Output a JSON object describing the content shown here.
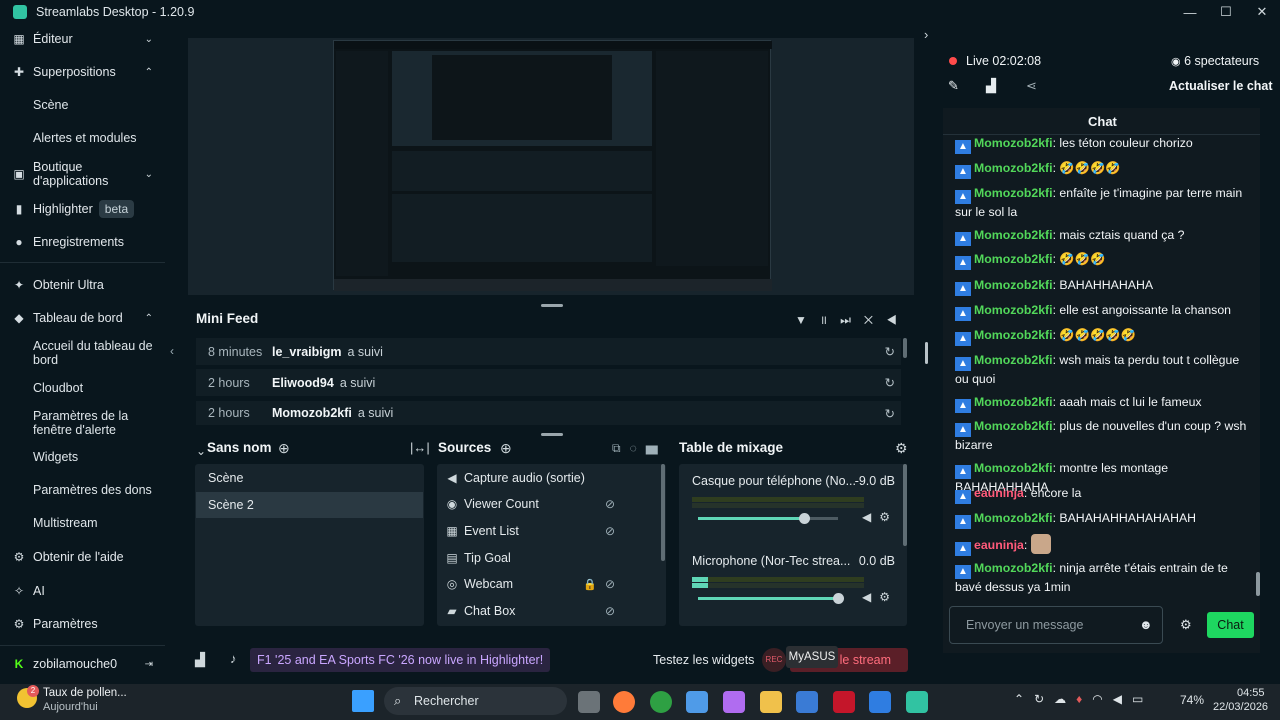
{
  "app": {
    "title": "Streamlabs Desktop - 1.20.9"
  },
  "window_controls": {
    "minimize": "—",
    "maximize": "☐",
    "close": "✕"
  },
  "sidebar": {
    "editor": "Éditeur",
    "overlays": "Superpositions",
    "scene": "Scène",
    "alerts": "Alertes et modules",
    "app_store": "Boutique d'applications",
    "highlighter": "Highlighter",
    "highlighter_badge": "beta",
    "recordings": "Enregistrements",
    "ultra": "Obtenir Ultra",
    "dashboard": "Tableau de bord",
    "dash_home": "Accueil du tableau de bord",
    "cloudbot": "Cloudbot",
    "alertbox_settings": "Paramètres de la fenêtre d'alerte",
    "widgets": "Widgets",
    "donation_settings": "Paramètres des dons",
    "multistream": "Multistream",
    "help": "Obtenir de l'aide",
    "ai": "AI",
    "settings": "Paramètres",
    "user": "zobilamouche0"
  },
  "minifeed": {
    "title": "Mini Feed",
    "rows": [
      {
        "time": "8 minutes",
        "user": "le_vraibigm",
        "action": "a suivi"
      },
      {
        "time": "2 hours",
        "user": "Eliwood94",
        "action": "a suivi"
      },
      {
        "time": "2 hours",
        "user": "Momozob2kfi",
        "action": "a suivi"
      }
    ]
  },
  "scenes": {
    "title": "Sans nom",
    "items": [
      "Scène",
      "Scène 2"
    ]
  },
  "sources": {
    "title": "Sources",
    "items": [
      "Capture audio (sortie)",
      "Viewer Count",
      "Event List",
      "Tip Goal",
      "Webcam",
      "Chat Box"
    ]
  },
  "mixer": {
    "title": "Table de mixage",
    "channels": [
      {
        "name": "Casque pour téléphone (No...",
        "db": "-9.0 dB",
        "level": 0.76
      },
      {
        "name": "Microphone (Nor-Tec strea...",
        "db": "0.0 dB",
        "level": 1.0
      }
    ]
  },
  "bottom": {
    "banner": "F1 '25 and EA Sports FC '26 now live in Highlighter!",
    "test_widgets": "Testez les widgets",
    "rec": "REC",
    "go_live": "r le stream",
    "tooltip": "MyASUS"
  },
  "live": {
    "status": "Live",
    "time": "02:02:08",
    "viewers": "6 spectateurs",
    "refresh": "Actualiser le chat"
  },
  "chat": {
    "title": "Chat",
    "messages": [
      {
        "user": "Momozob2kfi",
        "text": "les téton couleur chorizo"
      },
      {
        "user": "Momozob2kfi",
        "text": "🤣🤣🤣🤣"
      },
      {
        "user": "Momozob2kfi",
        "text": "enfaîte je t'imagine par terre main sur le sol la"
      },
      {
        "user": "Momozob2kfi",
        "text": "mais cztais quand ça ?"
      },
      {
        "user": "Momozob2kfi",
        "text": "🤣🤣🤣"
      },
      {
        "user": "Momozob2kfi",
        "text": "BAHAHHAHAHA"
      },
      {
        "user": "Momozob2kfi",
        "text": "elle est angoissante la chanson"
      },
      {
        "user": "Momozob2kfi",
        "text": "🤣🤣🤣🤣🤣"
      },
      {
        "user": "Momozob2kfi",
        "text": "wsh mais ta perdu tout t collègue ou quoi"
      },
      {
        "user": "Momozob2kfi",
        "text": "aaah mais ct lui le fameux"
      },
      {
        "user": "Momozob2kfi",
        "text": "plus de nouvelles d'un coup ? wsh bizarre"
      },
      {
        "user": "Momozob2kfi",
        "text": "montre les montage BAHAHAHHAHA"
      },
      {
        "user": "eauninja",
        "text": "encore la"
      },
      {
        "user": "Momozob2kfi",
        "text": "BAHAHAHHAHAHAHAH"
      },
      {
        "user": "eauninja",
        "text": ""
      },
      {
        "user": "Momozob2kfi",
        "text": "ninja arrête t'étais entrain de te bavé dessus ya 1min"
      }
    ],
    "input_placeholder": "Envoyer un message",
    "send": "Chat"
  },
  "taskbar": {
    "weather_title": "Taux de pollen...",
    "weather_sub": "Aujourd'hui",
    "search": "Rechercher",
    "battery": "74%",
    "time": "04:55",
    "date": "22/03/2026"
  },
  "colors": {
    "accent": "#31c3a2",
    "chat_green": "#52d85a",
    "chat_pink": "#ff5a7a",
    "send": "#1ed760"
  }
}
